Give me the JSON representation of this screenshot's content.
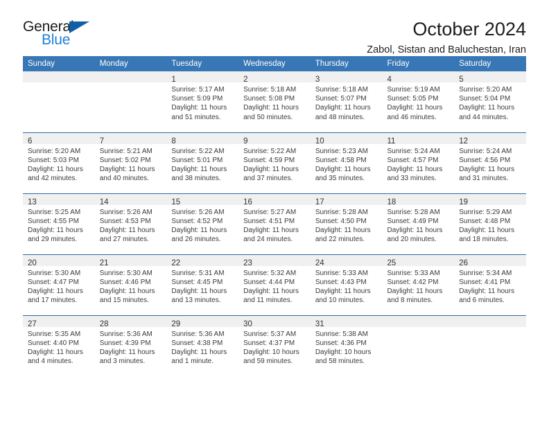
{
  "brand": {
    "name_part1": "General",
    "name_part2": "Blue",
    "triangle_color": "#1060a8",
    "blue_color": "#1d7fd4"
  },
  "header": {
    "title": "October 2024",
    "subtitle": "Zabol, Sistan and Baluchestan, Iran"
  },
  "calendar": {
    "header_bg": "#3877b5",
    "row_divider_color": "#2c68a8",
    "daynum_band_color": "#f0f0f0",
    "weekday_headers": [
      "Sunday",
      "Monday",
      "Tuesday",
      "Wednesday",
      "Thursday",
      "Friday",
      "Saturday"
    ],
    "weeks": [
      [
        {
          "day": "",
          "sunrise": "",
          "sunset": "",
          "daylight": "",
          "empty": true
        },
        {
          "day": "",
          "sunrise": "",
          "sunset": "",
          "daylight": "",
          "empty": true
        },
        {
          "day": "1",
          "sunrise": "Sunrise: 5:17 AM",
          "sunset": "Sunset: 5:09 PM",
          "daylight": "Daylight: 11 hours and 51 minutes."
        },
        {
          "day": "2",
          "sunrise": "Sunrise: 5:18 AM",
          "sunset": "Sunset: 5:08 PM",
          "daylight": "Daylight: 11 hours and 50 minutes."
        },
        {
          "day": "3",
          "sunrise": "Sunrise: 5:18 AM",
          "sunset": "Sunset: 5:07 PM",
          "daylight": "Daylight: 11 hours and 48 minutes."
        },
        {
          "day": "4",
          "sunrise": "Sunrise: 5:19 AM",
          "sunset": "Sunset: 5:05 PM",
          "daylight": "Daylight: 11 hours and 46 minutes."
        },
        {
          "day": "5",
          "sunrise": "Sunrise: 5:20 AM",
          "sunset": "Sunset: 5:04 PM",
          "daylight": "Daylight: 11 hours and 44 minutes."
        }
      ],
      [
        {
          "day": "6",
          "sunrise": "Sunrise: 5:20 AM",
          "sunset": "Sunset: 5:03 PM",
          "daylight": "Daylight: 11 hours and 42 minutes."
        },
        {
          "day": "7",
          "sunrise": "Sunrise: 5:21 AM",
          "sunset": "Sunset: 5:02 PM",
          "daylight": "Daylight: 11 hours and 40 minutes."
        },
        {
          "day": "8",
          "sunrise": "Sunrise: 5:22 AM",
          "sunset": "Sunset: 5:01 PM",
          "daylight": "Daylight: 11 hours and 38 minutes."
        },
        {
          "day": "9",
          "sunrise": "Sunrise: 5:22 AM",
          "sunset": "Sunset: 4:59 PM",
          "daylight": "Daylight: 11 hours and 37 minutes."
        },
        {
          "day": "10",
          "sunrise": "Sunrise: 5:23 AM",
          "sunset": "Sunset: 4:58 PM",
          "daylight": "Daylight: 11 hours and 35 minutes."
        },
        {
          "day": "11",
          "sunrise": "Sunrise: 5:24 AM",
          "sunset": "Sunset: 4:57 PM",
          "daylight": "Daylight: 11 hours and 33 minutes."
        },
        {
          "day": "12",
          "sunrise": "Sunrise: 5:24 AM",
          "sunset": "Sunset: 4:56 PM",
          "daylight": "Daylight: 11 hours and 31 minutes."
        }
      ],
      [
        {
          "day": "13",
          "sunrise": "Sunrise: 5:25 AM",
          "sunset": "Sunset: 4:55 PM",
          "daylight": "Daylight: 11 hours and 29 minutes."
        },
        {
          "day": "14",
          "sunrise": "Sunrise: 5:26 AM",
          "sunset": "Sunset: 4:53 PM",
          "daylight": "Daylight: 11 hours and 27 minutes."
        },
        {
          "day": "15",
          "sunrise": "Sunrise: 5:26 AM",
          "sunset": "Sunset: 4:52 PM",
          "daylight": "Daylight: 11 hours and 26 minutes."
        },
        {
          "day": "16",
          "sunrise": "Sunrise: 5:27 AM",
          "sunset": "Sunset: 4:51 PM",
          "daylight": "Daylight: 11 hours and 24 minutes."
        },
        {
          "day": "17",
          "sunrise": "Sunrise: 5:28 AM",
          "sunset": "Sunset: 4:50 PM",
          "daylight": "Daylight: 11 hours and 22 minutes."
        },
        {
          "day": "18",
          "sunrise": "Sunrise: 5:28 AM",
          "sunset": "Sunset: 4:49 PM",
          "daylight": "Daylight: 11 hours and 20 minutes."
        },
        {
          "day": "19",
          "sunrise": "Sunrise: 5:29 AM",
          "sunset": "Sunset: 4:48 PM",
          "daylight": "Daylight: 11 hours and 18 minutes."
        }
      ],
      [
        {
          "day": "20",
          "sunrise": "Sunrise: 5:30 AM",
          "sunset": "Sunset: 4:47 PM",
          "daylight": "Daylight: 11 hours and 17 minutes."
        },
        {
          "day": "21",
          "sunrise": "Sunrise: 5:30 AM",
          "sunset": "Sunset: 4:46 PM",
          "daylight": "Daylight: 11 hours and 15 minutes."
        },
        {
          "day": "22",
          "sunrise": "Sunrise: 5:31 AM",
          "sunset": "Sunset: 4:45 PM",
          "daylight": "Daylight: 11 hours and 13 minutes."
        },
        {
          "day": "23",
          "sunrise": "Sunrise: 5:32 AM",
          "sunset": "Sunset: 4:44 PM",
          "daylight": "Daylight: 11 hours and 11 minutes."
        },
        {
          "day": "24",
          "sunrise": "Sunrise: 5:33 AM",
          "sunset": "Sunset: 4:43 PM",
          "daylight": "Daylight: 11 hours and 10 minutes."
        },
        {
          "day": "25",
          "sunrise": "Sunrise: 5:33 AM",
          "sunset": "Sunset: 4:42 PM",
          "daylight": "Daylight: 11 hours and 8 minutes."
        },
        {
          "day": "26",
          "sunrise": "Sunrise: 5:34 AM",
          "sunset": "Sunset: 4:41 PM",
          "daylight": "Daylight: 11 hours and 6 minutes."
        }
      ],
      [
        {
          "day": "27",
          "sunrise": "Sunrise: 5:35 AM",
          "sunset": "Sunset: 4:40 PM",
          "daylight": "Daylight: 11 hours and 4 minutes."
        },
        {
          "day": "28",
          "sunrise": "Sunrise: 5:36 AM",
          "sunset": "Sunset: 4:39 PM",
          "daylight": "Daylight: 11 hours and 3 minutes."
        },
        {
          "day": "29",
          "sunrise": "Sunrise: 5:36 AM",
          "sunset": "Sunset: 4:38 PM",
          "daylight": "Daylight: 11 hours and 1 minute."
        },
        {
          "day": "30",
          "sunrise": "Sunrise: 5:37 AM",
          "sunset": "Sunset: 4:37 PM",
          "daylight": "Daylight: 10 hours and 59 minutes."
        },
        {
          "day": "31",
          "sunrise": "Sunrise: 5:38 AM",
          "sunset": "Sunset: 4:36 PM",
          "daylight": "Daylight: 10 hours and 58 minutes."
        },
        {
          "day": "",
          "sunrise": "",
          "sunset": "",
          "daylight": "",
          "empty": true
        },
        {
          "day": "",
          "sunrise": "",
          "sunset": "",
          "daylight": "",
          "empty": true
        }
      ]
    ]
  }
}
